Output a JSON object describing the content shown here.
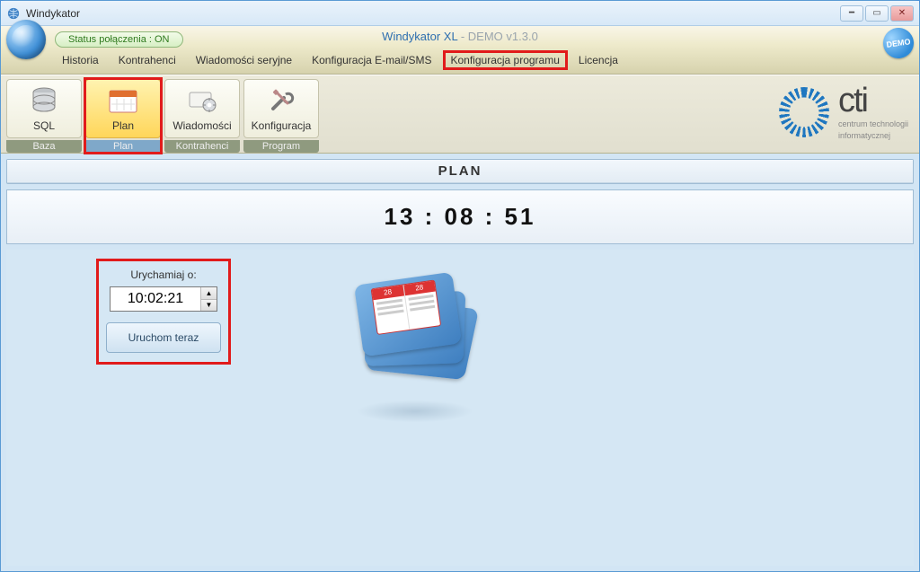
{
  "window": {
    "title": "Windykator"
  },
  "header": {
    "status": "Status połączenia : ON",
    "app_name": "Windykator XL",
    "app_sub": " - DEMO v1.3.0",
    "demo_badge": "DEMO"
  },
  "menu": {
    "items": [
      "Historia",
      "Kontrahenci",
      "Wiadomości seryjne",
      "Konfiguracja E-mail/SMS",
      "Konfiguracja programu",
      "Licencja"
    ],
    "highlighted_index": 4
  },
  "ribbon": {
    "groups": [
      {
        "label": "Baza",
        "buttons": [
          {
            "label": "SQL",
            "icon": "database-icon"
          }
        ]
      },
      {
        "label": "Plan",
        "highlight": true,
        "buttons": [
          {
            "label": "Plan",
            "icon": "calendar-icon",
            "active": true
          }
        ]
      },
      {
        "label": "Kontrahenci",
        "buttons": [
          {
            "label": "Wiadomości",
            "icon": "message-settings-icon"
          }
        ]
      },
      {
        "label": "Program",
        "buttons": [
          {
            "label": "Konfiguracja",
            "icon": "tools-icon"
          }
        ]
      }
    ]
  },
  "logo": {
    "line1": "centrum technologii",
    "line2": "informatycznej",
    "big": "cti"
  },
  "plan": {
    "title": "PLAN",
    "clock": "13 : 08 : 51",
    "launch_label": "Urychamiaj o:",
    "launch_time": "10:02:21",
    "run_now": "Uruchom teraz",
    "cal_day": "28"
  }
}
